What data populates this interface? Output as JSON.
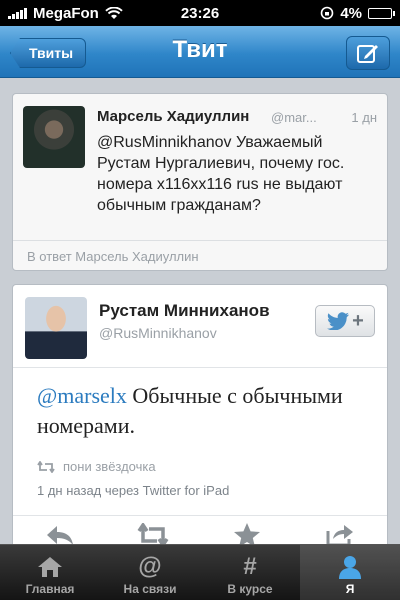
{
  "status_bar": {
    "carrier": "MegaFon",
    "time": "23:26",
    "battery": "4%"
  },
  "nav": {
    "back_label": "Твиты",
    "title": "Твит"
  },
  "reply_tweet": {
    "author_name": "Марсель Хадиуллин",
    "author_handle": "@mar...",
    "time": "1 дн",
    "text": "@RusMinnikhanov Уважаемый Рустам Нургалиевич, почему гос. номера х116хх116 rus не выдают обычным гражданам?",
    "footer": "В ответ Марсель Хадиуллин"
  },
  "main_tweet": {
    "author_name": "Рустам Минниханов",
    "author_handle": "@RusMinnikhanov",
    "mention": "@marselx",
    "text": "Обычные с обычными номерами.",
    "favorites": "пони звёздочка",
    "meta": "1 дн назад через Twitter for iPad"
  },
  "tabs": [
    {
      "label": "Главная",
      "icon": "home-icon"
    },
    {
      "label": "На связи",
      "icon": "at-icon"
    },
    {
      "label": "В курсе",
      "icon": "hash-icon"
    },
    {
      "label": "Я",
      "icon": "person-icon"
    }
  ],
  "colors": {
    "accent": "#2b7bbf",
    "nav_blue": "#2f86c9"
  }
}
